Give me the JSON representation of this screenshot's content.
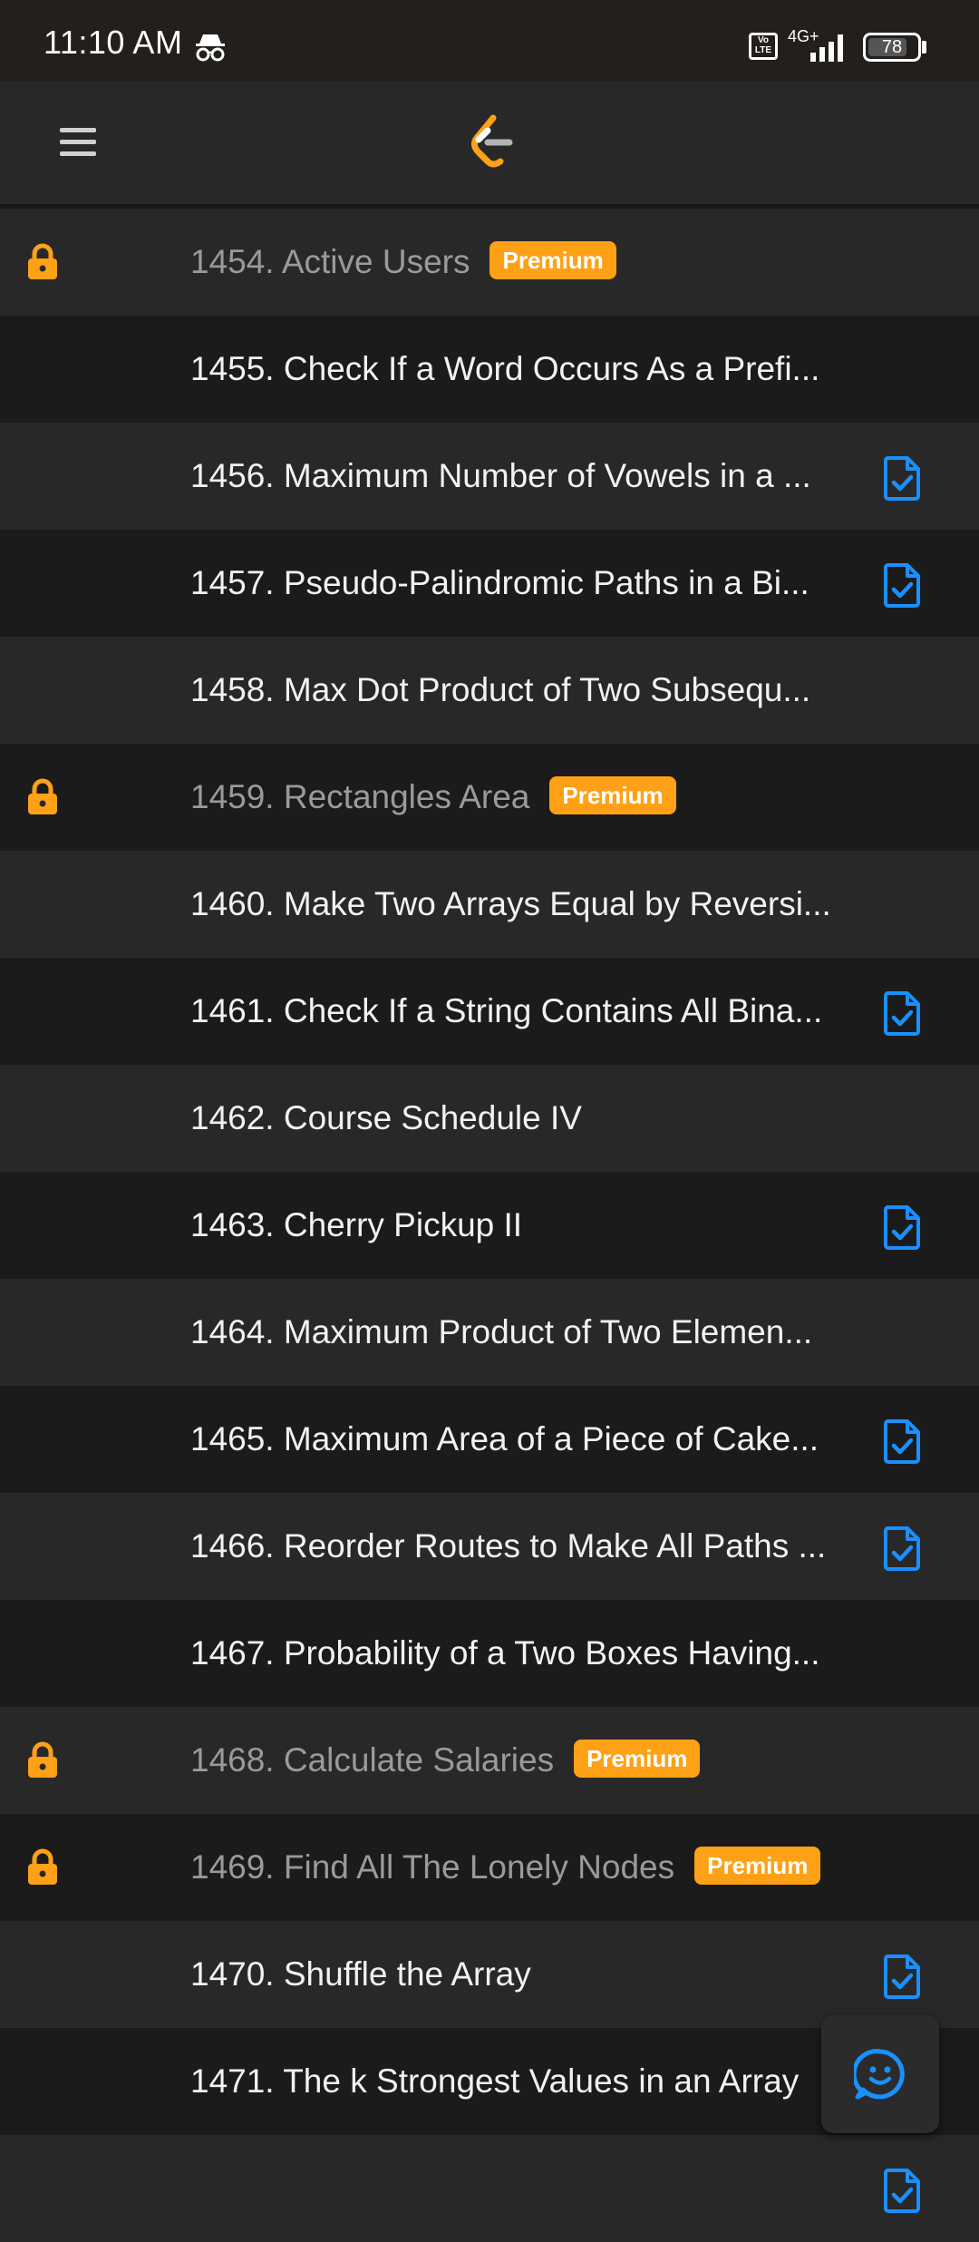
{
  "status_bar": {
    "time": "11:10 AM",
    "volte": "Vo LTE",
    "network": "4G+",
    "battery": "78"
  },
  "header": {
    "menu_icon": "hamburger-menu-icon",
    "logo_icon": "leetcode-logo-icon"
  },
  "colors": {
    "premium": "#ffa116",
    "solution_icon": "#1a90ff",
    "row_light": "#282828",
    "row_dark": "#1b1b1b"
  },
  "problems": [
    {
      "title": "1454. Active Users",
      "premium": true,
      "premium_label": "Premium",
      "has_solution": false
    },
    {
      "title": "1455. Check If a Word Occurs As a Prefi...",
      "premium": false,
      "has_solution": false
    },
    {
      "title": "1456. Maximum Number of Vowels in a ...",
      "premium": false,
      "has_solution": true
    },
    {
      "title": "1457. Pseudo-Palindromic Paths in a Bi...",
      "premium": false,
      "has_solution": true
    },
    {
      "title": "1458. Max Dot Product of Two Subsequ...",
      "premium": false,
      "has_solution": false
    },
    {
      "title": "1459. Rectangles Area",
      "premium": true,
      "premium_label": "Premium",
      "has_solution": false
    },
    {
      "title": "1460. Make Two Arrays Equal by Reversi...",
      "premium": false,
      "has_solution": false
    },
    {
      "title": "1461. Check If a String Contains All Bina...",
      "premium": false,
      "has_solution": true
    },
    {
      "title": "1462. Course Schedule IV",
      "premium": false,
      "has_solution": false
    },
    {
      "title": "1463. Cherry Pickup II",
      "premium": false,
      "has_solution": true
    },
    {
      "title": "1464. Maximum Product of Two Elemen...",
      "premium": false,
      "has_solution": false
    },
    {
      "title": "1465. Maximum Area of a Piece of Cake...",
      "premium": false,
      "has_solution": true
    },
    {
      "title": "1466. Reorder Routes to Make All Paths ...",
      "premium": false,
      "has_solution": true
    },
    {
      "title": "1467. Probability of a Two Boxes Having...",
      "premium": false,
      "has_solution": false
    },
    {
      "title": "1468. Calculate Salaries",
      "premium": true,
      "premium_label": "Premium",
      "has_solution": false
    },
    {
      "title": "1469. Find All The Lonely Nodes",
      "premium": true,
      "premium_label": "Premium",
      "has_solution": false
    },
    {
      "title": "1470. Shuffle the Array",
      "premium": false,
      "has_solution": true
    },
    {
      "title": "1471. The k Strongest Values in an Array",
      "premium": false,
      "has_solution": false
    },
    {
      "title": "",
      "premium": false,
      "has_solution": true
    }
  ],
  "feedback_button": {
    "icon": "smiley-feedback-icon"
  }
}
